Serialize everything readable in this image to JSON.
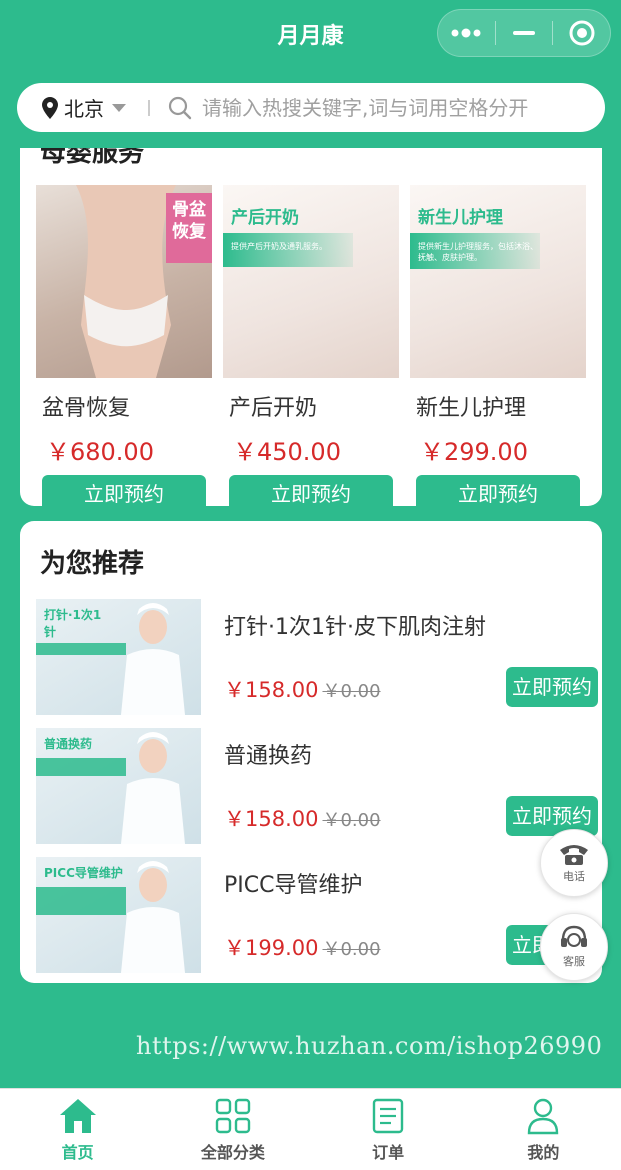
{
  "app": {
    "title": "月月康",
    "capsule": {
      "more": "more-icon",
      "minimize": "minimize-icon",
      "close": "target-icon"
    }
  },
  "search": {
    "city": "北京",
    "placeholder": "请输入热搜关键字,词与词用空格分开"
  },
  "maternal": {
    "title": "母婴服务",
    "items": [
      {
        "name": "盆骨恢复",
        "price": "￥680.00",
        "book": "立即预约",
        "banner": "骨盆恢复"
      },
      {
        "name": "产后开奶",
        "price": "￥450.00",
        "book": "立即预约",
        "banner": "产后开奶",
        "sub": "提供产后开奶及通乳服务。"
      },
      {
        "name": "新生儿护理",
        "price": "￥299.00",
        "book": "立即预约",
        "banner": "新生儿护理",
        "sub": "提供新生儿护理服务，包括沐浴、抚触、皮肤护理。"
      }
    ]
  },
  "recommend": {
    "title": "为您推荐",
    "items": [
      {
        "name": "打针·1次1针·皮下肌肉注射",
        "price": "￥158.00",
        "old": "￥0.00",
        "book": "立即预约",
        "banner": "打针·1次1针"
      },
      {
        "name": "普通换药",
        "price": "￥158.00",
        "old": "￥0.00",
        "book": "立即预约",
        "banner": "普通换药"
      },
      {
        "name": "PICC导管维护",
        "price": "￥199.00",
        "old": "￥0.00",
        "book": "立即预约",
        "banner": "PICC导管维护"
      }
    ]
  },
  "float": {
    "phone": "电话",
    "service": "客服"
  },
  "watermark": "https://www.huzhan.com/ishop26990",
  "tabs": [
    {
      "label": "首页",
      "icon": "home-icon"
    },
    {
      "label": "全部分类",
      "icon": "grid-icon"
    },
    {
      "label": "订单",
      "icon": "order-icon"
    },
    {
      "label": "我的",
      "icon": "user-icon"
    }
  ],
  "colors": {
    "primary": "#2dbb8d",
    "price": "#d62a2a",
    "tab_active": "#2dbb8d"
  }
}
